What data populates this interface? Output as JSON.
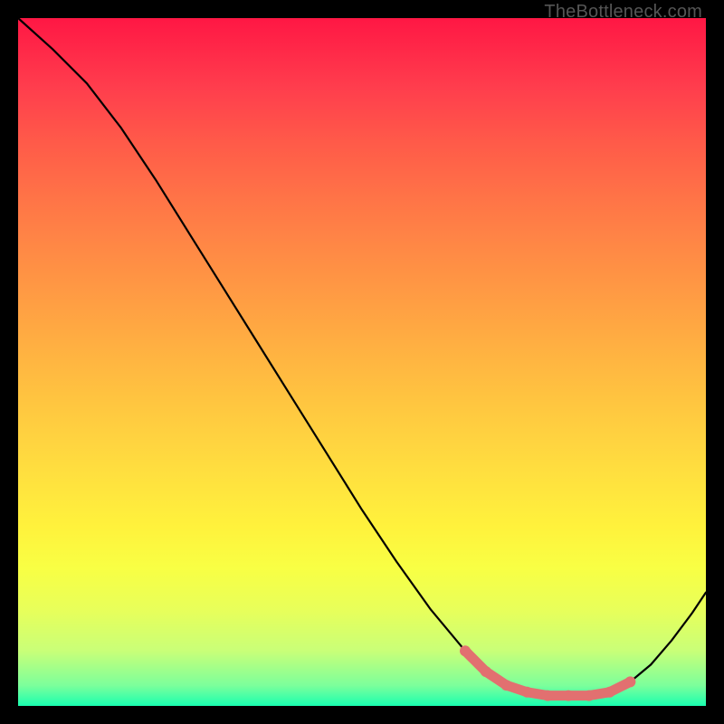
{
  "watermark": "TheBottleneck.com",
  "chart_data": {
    "type": "line",
    "title": "",
    "xlabel": "",
    "ylabel": "",
    "xlim": [
      0,
      100
    ],
    "ylim": [
      0,
      100
    ],
    "series": [
      {
        "name": "bottleneck-curve",
        "x": [
          0,
          5,
          10,
          15,
          20,
          25,
          30,
          35,
          40,
          45,
          50,
          55,
          60,
          65,
          68,
          71,
          74,
          77,
          80,
          83,
          86,
          89,
          92,
          95,
          98,
          100
        ],
        "values": [
          100,
          95.5,
          90.5,
          84.0,
          76.5,
          68.5,
          60.5,
          52.5,
          44.5,
          36.5,
          28.5,
          21.0,
          14.0,
          8.0,
          5.0,
          3.0,
          2.0,
          1.5,
          1.5,
          1.5,
          2.0,
          3.5,
          6.0,
          9.5,
          13.5,
          16.5
        ]
      },
      {
        "name": "highlight-segment",
        "x": [
          65,
          68,
          71,
          74,
          77,
          80,
          83,
          86,
          89
        ],
        "values": [
          8.0,
          5.0,
          3.0,
          2.0,
          1.5,
          1.5,
          1.5,
          2.0,
          3.5
        ]
      }
    ],
    "colors": {
      "curve": "#000000",
      "highlight": "#e27070",
      "background_top": "#ff1744",
      "background_bottom": "#1affb0"
    }
  }
}
